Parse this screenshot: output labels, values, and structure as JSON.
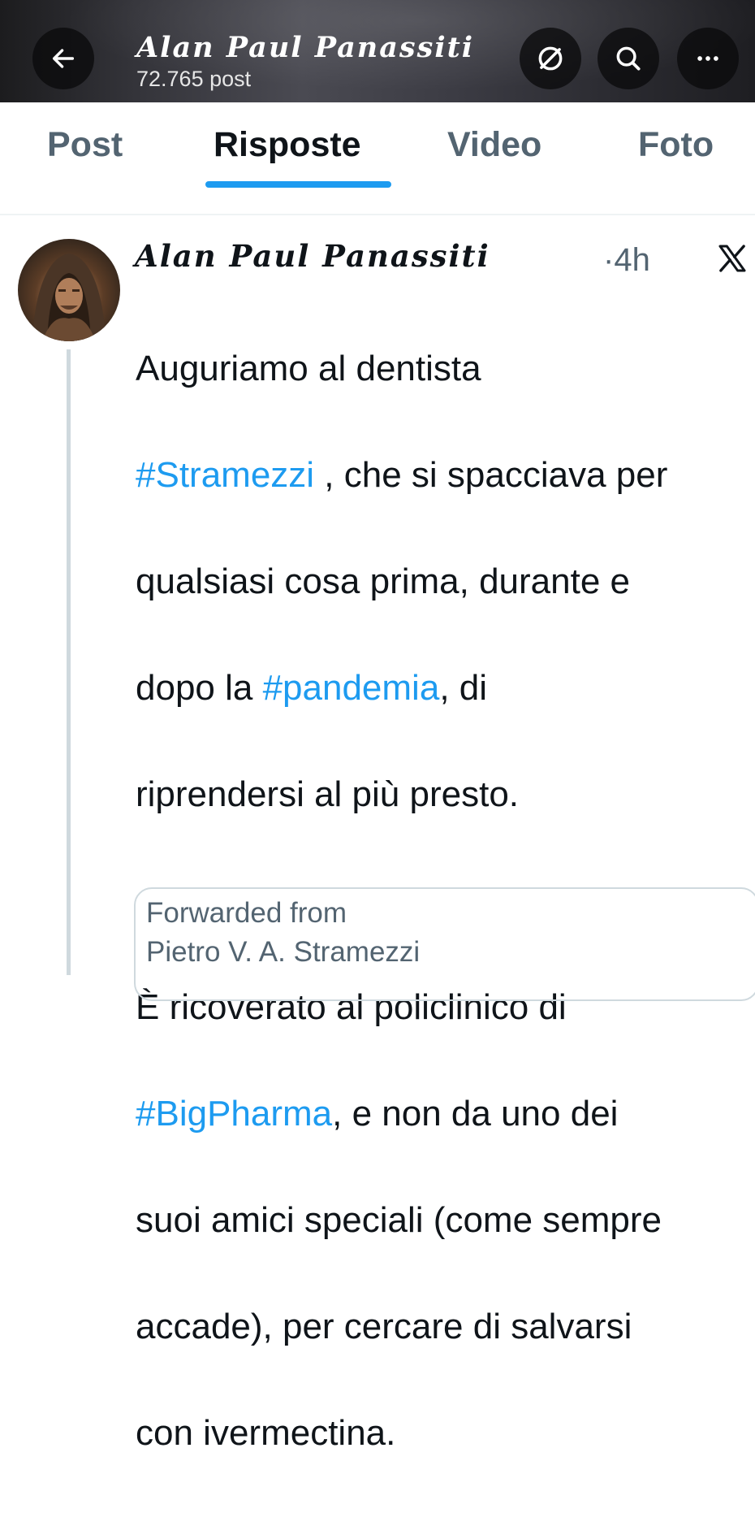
{
  "header": {
    "title": "Alan Paul Panassiti",
    "post_count": "72.765 post"
  },
  "tabs": [
    {
      "label": "Post"
    },
    {
      "label": "Risposte"
    },
    {
      "label": "Video"
    },
    {
      "label": "Foto"
    }
  ],
  "tweet": {
    "author": "Alan Paul Panassiti",
    "time": "4h",
    "separator": "·",
    "lines": {
      "l1": "Auguriamo al dentista",
      "l2_hashtag": "#Stramezzi",
      "l2_rest": " , che si spacciava per",
      "l3": "qualsiasi cosa prima, durante e",
      "l4_pre": "dopo la ",
      "l4_hashtag": "#pandemia",
      "l4_rest": ", di",
      "l5": "riprendersi al più presto.",
      "l6": "È ricoverato al policlinico di",
      "l7_hashtag": "#BigPharma",
      "l7_rest": ", e non da uno dei",
      "l8": "suoi amici speciali (come sempre",
      "l9": "accade), per cercare di salvarsi",
      "l10": "con ivermectina."
    }
  },
  "forward_card": {
    "line1": "Forwarded from",
    "line2": "Pietro V. A. Stramezzi"
  },
  "colors": {
    "accent": "#1d9bf0",
    "text": "#0f1419",
    "muted": "#536471"
  },
  "icons": [
    "arrow-left-icon",
    "slash-circle-icon",
    "search-icon",
    "more-icon",
    "x-logo-icon"
  ]
}
